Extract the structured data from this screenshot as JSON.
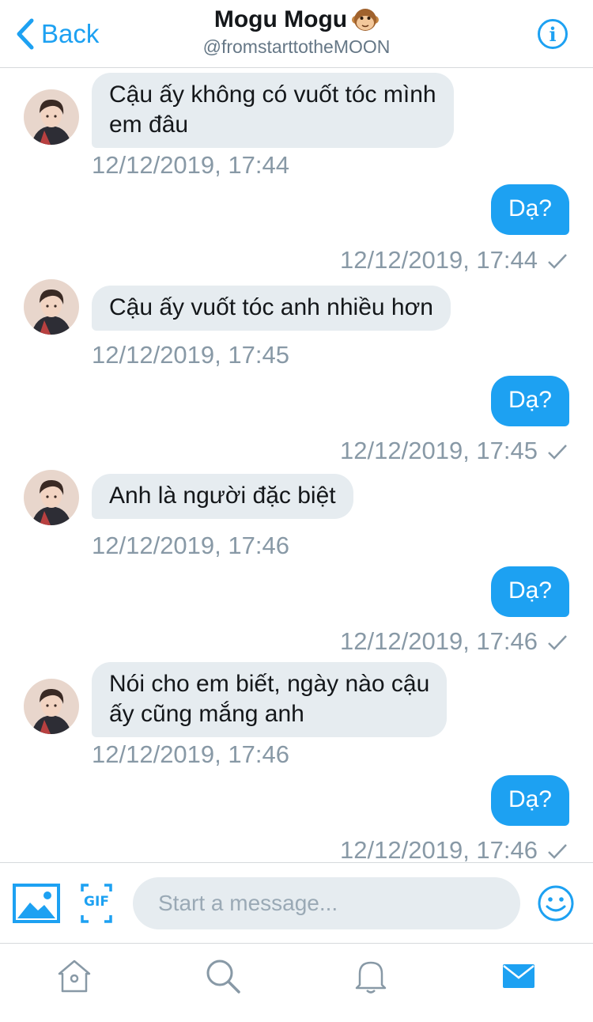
{
  "header": {
    "back_label": "Back",
    "title": "Mogu Mogu",
    "title_emoji": "monkey-face-icon",
    "handle": "@fromstarttotheMOON"
  },
  "colors": {
    "accent": "#1da1f2",
    "incoming_bubble": "#e6ecf0",
    "timestamp": "#8899a6",
    "divider": "#d6d9dc"
  },
  "messages": [
    {
      "direction": "in",
      "lines": [
        "Cậu ấy không có vuốt tóc mình",
        "em đâu"
      ],
      "time": "12/12/2019, 17:44"
    },
    {
      "direction": "out",
      "lines": [
        "Dạ?"
      ],
      "time": "12/12/2019, 17:44",
      "read_icon": "checkmark-icon"
    },
    {
      "direction": "in",
      "lines": [
        "Cậu ấy vuốt tóc anh nhiều hơn"
      ],
      "time": "12/12/2019, 17:45"
    },
    {
      "direction": "out",
      "lines": [
        "Dạ?"
      ],
      "time": "12/12/2019, 17:45",
      "read_icon": "checkmark-icon"
    },
    {
      "direction": "in",
      "lines": [
        "Anh là người đặc biệt"
      ],
      "time": "12/12/2019, 17:46"
    },
    {
      "direction": "out",
      "lines": [
        "Dạ?"
      ],
      "time": "12/12/2019, 17:46",
      "read_icon": "checkmark-icon"
    },
    {
      "direction": "in",
      "lines": [
        "Nói cho em biết, ngày nào cậu",
        "ấy cũng mắng anh"
      ],
      "time": "12/12/2019, 17:46"
    },
    {
      "direction": "out",
      "lines": [
        "Dạ?"
      ],
      "time": "12/12/2019, 17:46",
      "read_icon": "checkmark-icon"
    }
  ],
  "composer": {
    "placeholder": "Start a message...",
    "media_icon": "image-icon",
    "gif_label": "GIF",
    "emoji_icon": "smiley-icon"
  },
  "tabbar": {
    "tabs": [
      {
        "name": "home-icon",
        "active": false
      },
      {
        "name": "search-icon",
        "active": false
      },
      {
        "name": "notifications-bell-icon",
        "active": false
      },
      {
        "name": "messages-envelope-icon",
        "active": true
      }
    ]
  }
}
